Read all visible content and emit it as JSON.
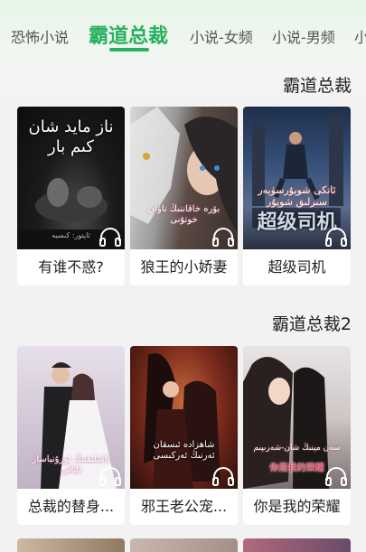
{
  "tabs": [
    {
      "label": "恐怖小说",
      "active": false
    },
    {
      "label": "霸道总裁",
      "active": true
    },
    {
      "label": "小说-女频",
      "active": false
    },
    {
      "label": "小说-男频",
      "active": false
    },
    {
      "label": "小",
      "active": false
    }
  ],
  "colors": {
    "accent": "#27b15f",
    "text": "#222222",
    "tab_inactive": "#555555",
    "card_bg": "#ffffff",
    "page_bg": "#f2f2f2"
  },
  "sections": [
    {
      "title": "霸道总裁",
      "books": [
        {
          "title": "有谁不惑?",
          "cover_text": "ناز مايد شان\nكىم بار",
          "cover_subtext": "ئاپتور: كىسيە",
          "icon": "headphones-icon"
        },
        {
          "title": "狼王的小娇妻",
          "cover_text": "بۆرە خاقاننىڭ ناۋان خوتۇنى",
          "icon": "headphones-icon"
        },
        {
          "title": "超级司机",
          "cover_text": "ئاتكى شوپۇرسۈپەر\nسىرلىق شوپۇر",
          "cover_subtext": "超级司机",
          "icon": "headphones-icon"
        }
      ]
    },
    {
      "title": "霸道总裁2",
      "books": [
        {
          "title": "总裁的替身...",
          "cover_text": "باشلىقنىڭ ئورۇنباسار ئايالى",
          "icon": "headphones-icon"
        },
        {
          "title": "邪王老公宠...",
          "cover_text": "شاھزادە ئىسقان\nئەرنىڭ ئەركىسى",
          "icon": "headphones-icon"
        },
        {
          "title": "你是我的荣耀",
          "cover_text": "سەن مېنىڭ شان-شەرىپىم",
          "cover_subtext": "你是我的荣耀",
          "icon": "headphones-icon"
        }
      ]
    }
  ]
}
